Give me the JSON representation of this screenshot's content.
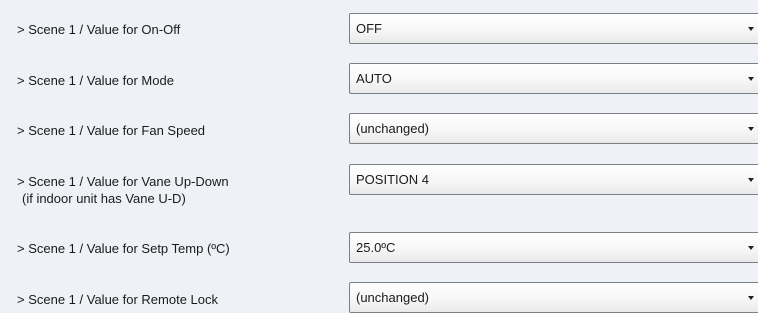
{
  "rows": [
    {
      "label": "> Scene 1 / Value for On-Off",
      "value": "OFF"
    },
    {
      "label": "> Scene 1 / Value for Mode",
      "value": "AUTO"
    },
    {
      "label": "> Scene 1 / Value for Fan Speed",
      "value": "(unchanged)"
    },
    {
      "label": "> Scene 1 / Value for Vane Up-Down",
      "sublabel": "(if indoor unit has Vane U-D)",
      "value": "POSITION 4"
    },
    {
      "label": "> Scene 1 / Value for Setp Temp (ºC)",
      "value": "25.0ºC"
    },
    {
      "label": "> Scene 1 / Value for Remote Lock",
      "value": "(unchanged)"
    }
  ],
  "icons": {
    "dropdown": "chevron-down-icon"
  }
}
